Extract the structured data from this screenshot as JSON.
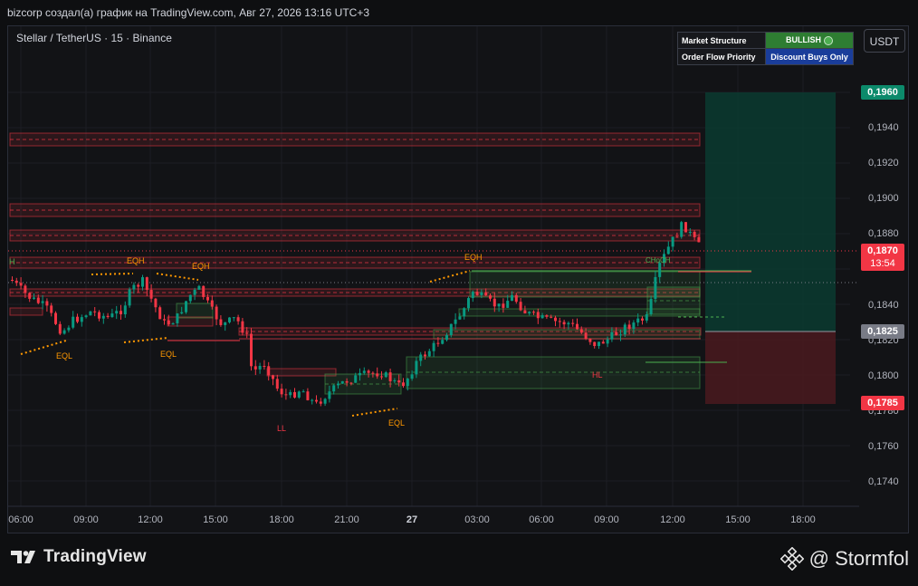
{
  "window": {
    "title": "bizcorp создал(а) график на TradingView.com, Авг 27, 2026 13:16 UTC+3"
  },
  "symbol": {
    "label": "Stellar / TetherUS · 15 · Binance"
  },
  "currency_button": "USDT",
  "info_table": {
    "rows": [
      {
        "key": "Market Structure",
        "value": "BULLISH",
        "value_color": "#2e7d32"
      },
      {
        "key": "Order Flow Priority",
        "value": "Discount Buys Only",
        "value_color": "#1a3d9a"
      }
    ]
  },
  "price_axis": {
    "ticks": [
      "0,1940",
      "0,1920",
      "0,1900",
      "0,1880",
      "0,1840",
      "0,1820",
      "0,1800",
      "0,1780",
      "0,1760",
      "0,1740"
    ]
  },
  "price_labels": {
    "take_profit": {
      "text": "0,1960",
      "color": "#0c8a6b"
    },
    "current": {
      "text": "0,1870",
      "color": "#f23645"
    },
    "countdown": "13:54",
    "entry": {
      "text": "0,1825",
      "color": "#787b86"
    },
    "stop_loss": {
      "text": "0,1785",
      "color": "#f23645"
    }
  },
  "time_axis": {
    "ticks": [
      "06:00",
      "09:00",
      "12:00",
      "15:00",
      "18:00",
      "21:00",
      "27",
      "03:00",
      "06:00",
      "09:00",
      "12:00",
      "15:00",
      "18:00"
    ]
  },
  "chart_labels": {
    "eqh1": "EQH",
    "eqh2": "EQH",
    "eqh3": "EQH",
    "eql1": "EQL",
    "eql2": "EQL",
    "eql3": "EQL",
    "ll": "LL",
    "hl": "HL",
    "choch": "CHoCH",
    "h": "H"
  },
  "colors": {
    "up": "#089981",
    "down": "#f23645",
    "supply_zone": "#f23645",
    "demand_zone": "#4caf50",
    "liquidity": "#ff9800"
  },
  "footer": {
    "brand": "TradingView",
    "author": "@ Stormfol"
  }
}
